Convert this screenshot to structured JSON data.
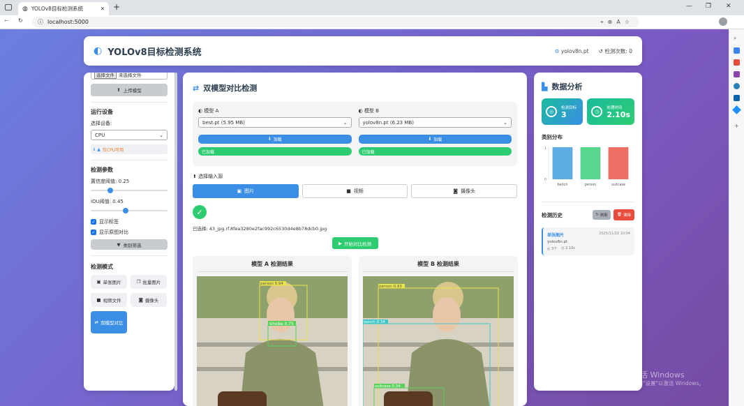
{
  "browser": {
    "tab_title": "YOLOv8目标检测系统",
    "url": "localhost:5000"
  },
  "header": {
    "title": "YOLOv8目标检测系统",
    "model": "yolov8n.pt",
    "count_label": "检测次数: 0"
  },
  "sidebar": {
    "file_btn": "选择文件",
    "file_status": "未选择文件",
    "upload_btn": "上传模型",
    "device_heading": "运行设备",
    "device_label": "选择设备:",
    "device_value": "CPU",
    "device_note": "仅CPU可用",
    "params_heading": "检测参数",
    "conf_label": "置信度阈值: 0.25",
    "conf_value": 0.25,
    "iou_label": "IOU阈值: 0.45",
    "iou_value": 0.45,
    "show_labels": "显示标签",
    "show_compare": "显示原图对比",
    "filter_btn": "类别筛选",
    "mode_heading": "检测模式",
    "modes": [
      "单张图片",
      "批量图片",
      "视频文件",
      "摄像头",
      "双模型对比"
    ]
  },
  "main": {
    "title": "双模型对比检测",
    "model_a_label": "模型 A",
    "model_a_value": "best.pt (5.95 MB)",
    "model_b_label": "模型 B",
    "model_b_value": "yolov8n.pt (6.23 MB)",
    "load_btn": "加载",
    "loaded": "已加载",
    "source_heading": "选择输入源",
    "sources": [
      "图片",
      "视频",
      "摄像头"
    ],
    "selected_file": "已选择: 43_jpg.rf.8fea3280e2fac992c6530d4e8b78dcb0.jpg",
    "start_btn": "开始对比检测",
    "result_a_title": "模型 A 检测结果",
    "result_b_title": "模型 B 检测结果",
    "result_a_boxes": [
      "person 0.94",
      "smoke 0.75"
    ],
    "result_b_boxes": [
      "person 0.93",
      "bench 0.34",
      "suitcase 0.34"
    ]
  },
  "right": {
    "title": "数据分析",
    "stat1_label": "检测目标",
    "stat1_value": "3",
    "stat2_label": "处理时间",
    "stat2_value": "2.10s",
    "dist_heading": "类别分布",
    "history_heading": "检测历史",
    "refresh_btn": "刷新",
    "clear_btn": "清除",
    "history_item": {
      "type": "单张图片",
      "time": "2025/11/22 10:04",
      "model": "yolov8n.pt",
      "count": "3个",
      "duration": "2.10s"
    }
  },
  "chart_data": {
    "type": "bar",
    "categories": [
      "bench",
      "person",
      "suitcase"
    ],
    "values": [
      1,
      1,
      1
    ],
    "ylim": [
      0,
      1
    ],
    "colors": [
      "#5dade2",
      "#58d68d",
      "#ec7063"
    ]
  },
  "watermark": {
    "line1": "激活 Windows",
    "line2": "转到\"设置\"以激活 Windows。"
  }
}
